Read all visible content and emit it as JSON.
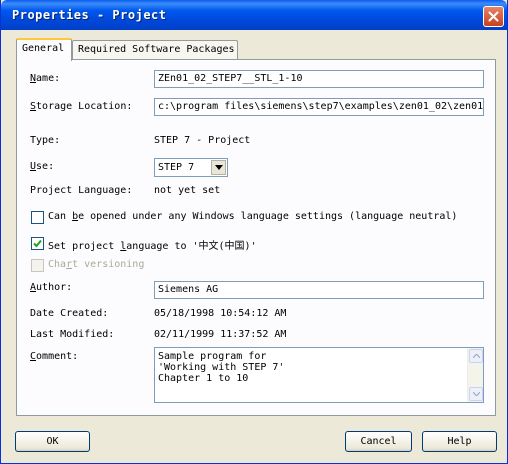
{
  "window": {
    "title": "Properties - Project"
  },
  "tabs": [
    {
      "label": "General",
      "active": true
    },
    {
      "label": "Required Software Packages",
      "active": false
    }
  ],
  "fields": {
    "name": {
      "label_pre": "",
      "label_key": "N",
      "label_post": "ame:",
      "value": "ZEn01_02_STEP7__STL_1-10"
    },
    "storage_location": {
      "label_pre": "",
      "label_key": "S",
      "label_post": "torage Location:",
      "value": "c:\\program files\\siemens\\step7\\examples\\zen01_02\\zen01_"
    },
    "type": {
      "label": "Type:",
      "value": "STEP 7 - Project"
    },
    "use": {
      "label_pre": "",
      "label_key": "U",
      "label_post": "se:",
      "value": "STEP 7"
    },
    "project_language": {
      "label": "Project Language:",
      "value": "not yet set"
    },
    "author": {
      "label_pre": "",
      "label_key": "A",
      "label_post": "uthor:",
      "value": "Siemens AG"
    },
    "date_created": {
      "label": "Date Created:",
      "value": "05/18/1998 10:54:12 AM"
    },
    "last_modified": {
      "label": "Last Modified:",
      "value": "02/11/1999 11:37:52 AM"
    },
    "comment": {
      "label_pre": "",
      "label_key": "C",
      "label_post": "omment:",
      "lines": [
        "Sample program for",
        "'Working with STEP 7'",
        "Chapter 1 to 10"
      ]
    }
  },
  "checkboxes": {
    "any_language": {
      "pre": "Can ",
      "key": "b",
      "post": "e opened under any Windows language settings (language neutral)",
      "checked": false,
      "enabled": true
    },
    "set_language": {
      "pre": "Set project ",
      "key": "l",
      "post": "anguage to '中文(中国)'",
      "checked": true,
      "enabled": true
    },
    "chart_versioning": {
      "pre": "Cha",
      "key": "r",
      "post": "t versioning",
      "checked": false,
      "enabled": false
    }
  },
  "buttons": {
    "ok": "OK",
    "cancel": "Cancel",
    "help": "Help"
  },
  "colors": {
    "titlebar": "#0058ee",
    "dialog_bg": "#ece9d8",
    "tab_highlight": "#ffc73c",
    "field_border": "#7f9db9"
  },
  "icons": {
    "close": "close-icon",
    "dropdown": "chevron-down-icon",
    "scroll_up": "chevron-up-icon",
    "scroll_down": "chevron-down-icon",
    "check": "checkmark-icon"
  }
}
